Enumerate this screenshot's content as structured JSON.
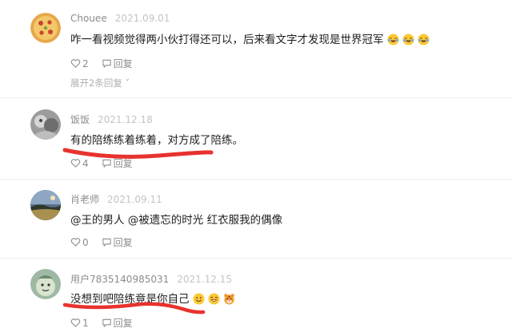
{
  "comments": [
    {
      "author": "Chouee",
      "date": "2021.09.01",
      "text": "咋一看视频觉得两小伙打得还可以，后来看文字才发现是世界冠军",
      "likes": "2",
      "reply_label": "回复",
      "expand_label": "展开2条回复 ˅"
    },
    {
      "author": "饭饭",
      "date": "2021.12.18",
      "text": "有的陪练练着练着，对方成了陪练。",
      "likes": "4",
      "reply_label": "回复"
    },
    {
      "author": "肖老师",
      "date": "2021.09.11",
      "text": "@王的男人  @被遗忘的时光  红衣服我的偶像",
      "likes": "0",
      "reply_label": "回复"
    },
    {
      "author": "用户7835140985031",
      "date": "2021.12.15",
      "text": "没想到吧陪练竟是你自己",
      "likes": "1",
      "reply_label": "回复"
    }
  ],
  "icons": {
    "like": "heart-outline-icon",
    "reply": "speech-bubble-icon",
    "laugh_emoji": "laughing-tears-emoji",
    "grin_emoji": "grinning-emoji",
    "tiger_emoji": "tiger-face-emoji"
  },
  "colors": {
    "annotation_red": "#e8322e",
    "meta_gray": "#8c8c8c",
    "date_gray": "#c4c4c4"
  }
}
